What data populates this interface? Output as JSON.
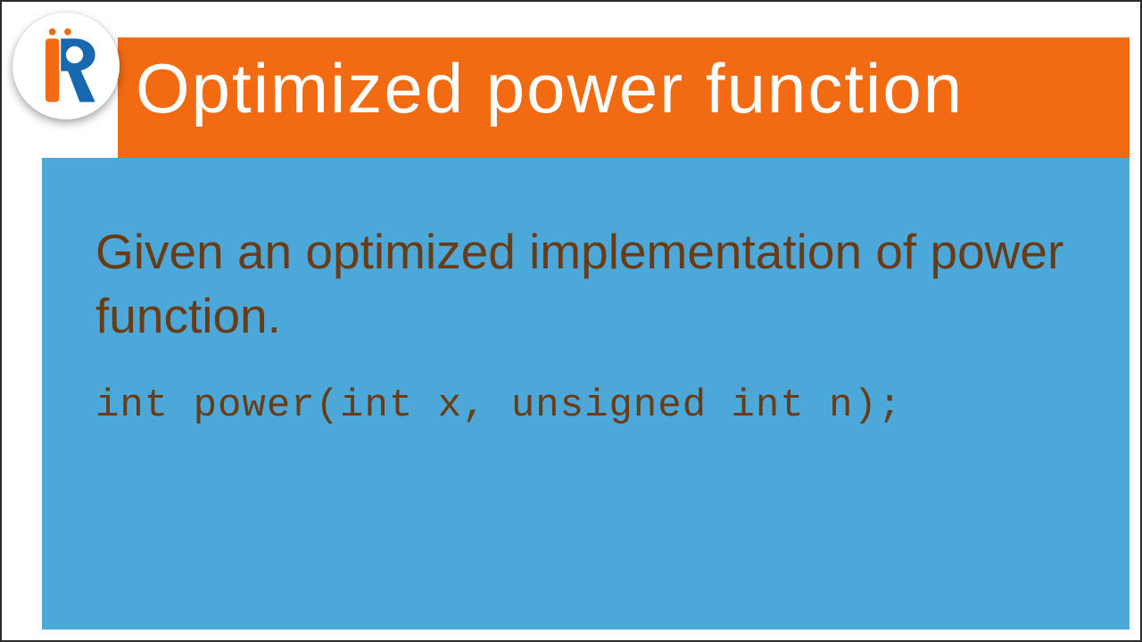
{
  "header": {
    "title": "Optimized power function"
  },
  "body": {
    "description": "Given an optimized implementation of power function.",
    "code": "int power(int x, unsigned int n);"
  },
  "logo": {
    "name": "IR Logo",
    "colors": {
      "orange": "#f26a11",
      "blue": "#1768b0"
    }
  }
}
